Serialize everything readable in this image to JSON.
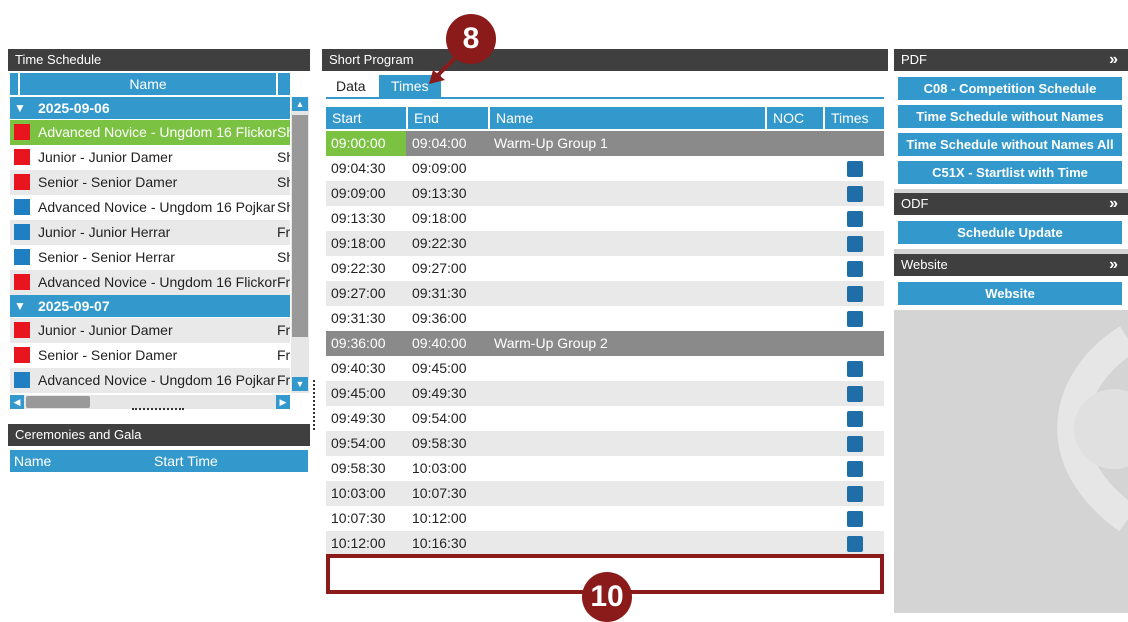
{
  "left": {
    "time_schedule_title": "Time Schedule",
    "col_name": "Name",
    "groups": [
      {
        "date": "2025-09-06",
        "events": [
          {
            "name": "Advanced Novice - Ungdom 16 Flickor",
            "c2": "Sh",
            "color": "#e8141e",
            "selected": true
          },
          {
            "name": "Junior - Junior Damer",
            "c2": "Sh",
            "color": "#e8141e"
          },
          {
            "name": "Senior - Senior Damer",
            "c2": "Sh",
            "color": "#e8141e"
          },
          {
            "name": "Advanced Novice - Ungdom 16 Pojkar",
            "c2": "Sh",
            "color": "#1f7fc2"
          },
          {
            "name": "Junior - Junior Herrar",
            "c2": "Fr",
            "color": "#1f7fc2"
          },
          {
            "name": "Senior - Senior Herrar",
            "c2": "Sh",
            "color": "#1f7fc2"
          },
          {
            "name": "Advanced Novice - Ungdom 16 Flickor",
            "c2": "Fr",
            "color": "#e8141e"
          }
        ]
      },
      {
        "date": "2025-09-07",
        "events": [
          {
            "name": "Junior - Junior Damer",
            "c2": "Fr",
            "color": "#e8141e"
          },
          {
            "name": "Senior - Senior Damer",
            "c2": "Fr",
            "color": "#e8141e"
          },
          {
            "name": "Advanced Novice - Ungdom 16 Pojkar",
            "c2": "Fr",
            "color": "#1f7fc2"
          }
        ]
      }
    ],
    "ceremonies_title": "Ceremonies and Gala",
    "cer_col_name": "Name",
    "cer_col_start": "Start Time"
  },
  "center": {
    "title": "Short Program",
    "tabs": [
      "Data",
      "Times"
    ],
    "columns": [
      "Start",
      "End",
      "Name",
      "NOC",
      "Times"
    ],
    "rows": [
      {
        "start": "09:00:00",
        "end": "09:04:00",
        "name": "Warm-Up Group 1",
        "type": "group",
        "selected": true
      },
      {
        "start": "09:04:30",
        "end": "09:09:00",
        "name": "",
        "type": "row"
      },
      {
        "start": "09:09:00",
        "end": "09:13:30",
        "name": "",
        "type": "row"
      },
      {
        "start": "09:13:30",
        "end": "09:18:00",
        "name": "",
        "type": "row"
      },
      {
        "start": "09:18:00",
        "end": "09:22:30",
        "name": "",
        "type": "row"
      },
      {
        "start": "09:22:30",
        "end": "09:27:00",
        "name": "",
        "type": "row"
      },
      {
        "start": "09:27:00",
        "end": "09:31:30",
        "name": "",
        "type": "row"
      },
      {
        "start": "09:31:30",
        "end": "09:36:00",
        "name": "",
        "type": "row"
      },
      {
        "start": "09:36:00",
        "end": "09:40:00",
        "name": "Warm-Up Group 2",
        "type": "group"
      },
      {
        "start": "09:40:30",
        "end": "09:45:00",
        "name": "",
        "type": "row"
      },
      {
        "start": "09:45:00",
        "end": "09:49:30",
        "name": "",
        "type": "row"
      },
      {
        "start": "09:49:30",
        "end": "09:54:00",
        "name": "",
        "type": "row"
      },
      {
        "start": "09:54:00",
        "end": "09:58:30",
        "name": "",
        "type": "row"
      },
      {
        "start": "09:58:30",
        "end": "10:03:00",
        "name": "",
        "type": "row"
      },
      {
        "start": "10:03:00",
        "end": "10:07:30",
        "name": "",
        "type": "row"
      },
      {
        "start": "10:07:30",
        "end": "10:12:00",
        "name": "",
        "type": "row"
      },
      {
        "start": "10:12:00",
        "end": "10:16:30",
        "name": "",
        "type": "row"
      }
    ]
  },
  "right": {
    "pdf_title": "PDF",
    "pdf_buttons": [
      "C08 - Competition Schedule",
      "Time Schedule without Names",
      "Time Schedule without Names All",
      "C51X - Startlist with Time"
    ],
    "odf_title": "ODF",
    "odf_buttons": [
      "Schedule Update"
    ],
    "website_title": "Website",
    "website_buttons": [
      "Website"
    ],
    "expand_glyph": "»"
  },
  "annotations": {
    "badge_top": "8",
    "badge_bottom": "10"
  },
  "colors": {
    "accent": "#3399cc",
    "header": "#3f3f3f",
    "selected": "#7cc242",
    "group_row": "#8a8a8a",
    "annotation": "#8b1a1a"
  }
}
